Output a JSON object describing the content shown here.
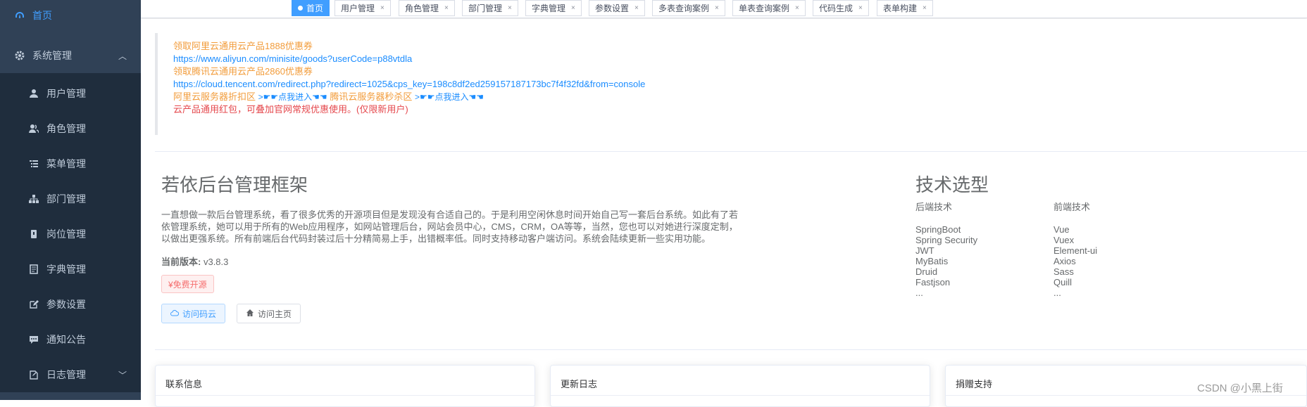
{
  "sidebar": {
    "home": "首页",
    "system": "系统管理",
    "items": [
      {
        "label": "用户管理",
        "icon": "user-icon"
      },
      {
        "label": "角色管理",
        "icon": "peoples-icon"
      },
      {
        "label": "菜单管理",
        "icon": "tree-table-icon"
      },
      {
        "label": "部门管理",
        "icon": "tree-icon"
      },
      {
        "label": "岗位管理",
        "icon": "post-icon"
      },
      {
        "label": "字典管理",
        "icon": "dict-icon"
      },
      {
        "label": "参数设置",
        "icon": "edit-icon"
      },
      {
        "label": "通知公告",
        "icon": "message-icon"
      }
    ],
    "log": "日志管理"
  },
  "tags": [
    {
      "label": "首页",
      "active": true
    },
    {
      "label": "用户管理"
    },
    {
      "label": "角色管理"
    },
    {
      "label": "部门管理"
    },
    {
      "label": "字典管理"
    },
    {
      "label": "参数设置"
    },
    {
      "label": "多表查询案例"
    },
    {
      "label": "单表查询案例"
    },
    {
      "label": "代码生成"
    },
    {
      "label": "表单构建"
    }
  ],
  "notice": {
    "line1": "领取阿里云通用云产品1888优惠券",
    "line2": "https://www.aliyun.com/minisite/goods?userCode=p88vtdla",
    "line3": "领取腾讯云通用云产品2860优惠券",
    "line4": "https://cloud.tencent.com/redirect.php?redirect=1025&cps_key=198c8df2ed259157187173bc7f4f32fd&from=console",
    "line5_a": "阿里云服务器折扣区",
    "line5_b": ">☛☛点我进入☚☚",
    "line5_c": "腾讯云服务器秒杀区",
    "line5_d": ">☛☛点我进入☚☚",
    "line6": "云产品通用红包，可叠加官网常规优惠使用。(仅限新用户)"
  },
  "intro": {
    "title": "若依后台管理框架",
    "desc": "一直想做一款后台管理系统，看了很多优秀的开源项目但是发现没有合适自己的。于是利用空闲休息时间开始自己写一套后台系统。如此有了若依管理系统，她可以用于所有的Web应用程序，如网站管理后台，网站会员中心，CMS，CRM，OA等等，当然，您也可以对她进行深度定制，以做出更强系统。所有前端后台代码封装过后十分精简易上手，出错概率低。同时支持移动客户端访问。系统会陆续更新一些实用功能。",
    "version_label": "当前版本:",
    "version": "v3.8.3",
    "free": "¥免费开源",
    "btn_gitee": "访问码云",
    "btn_home": "访问主页"
  },
  "tech": {
    "title": "技术选型",
    "backend_head": "后端技术",
    "backend": [
      "SpringBoot",
      "Spring Security",
      "JWT",
      "MyBatis",
      "Druid",
      "Fastjson",
      "..."
    ],
    "frontend_head": "前端技术",
    "frontend": [
      "Vue",
      "Vuex",
      "Element-ui",
      "Axios",
      "Sass",
      "Quill",
      "..."
    ]
  },
  "cards": {
    "contact": "联系信息",
    "changelog": "更新日志",
    "donate": "捐赠支持"
  },
  "watermark": "CSDN @小黑上街"
}
